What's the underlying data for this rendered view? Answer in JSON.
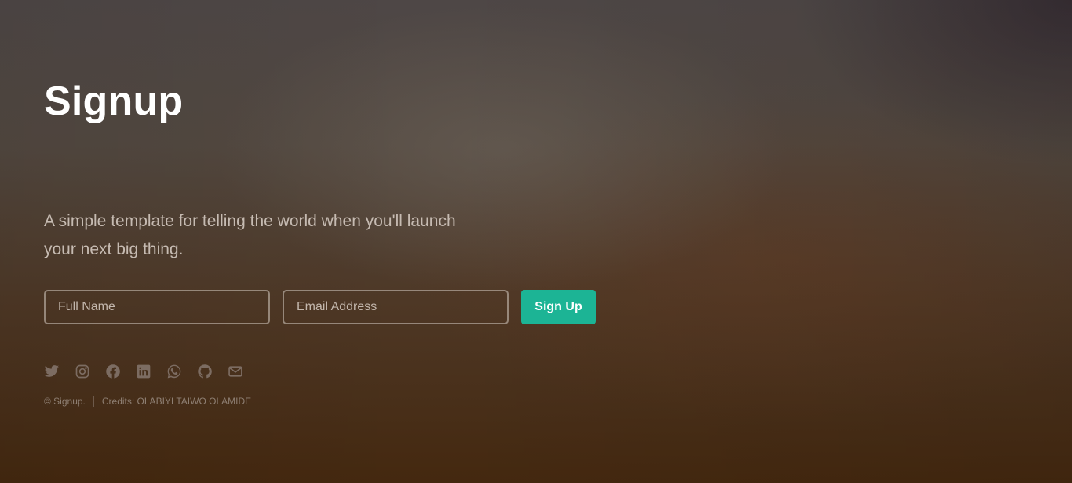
{
  "page": {
    "title": "Signup",
    "tagline": "A simple template for telling the world when you'll launch your next big thing."
  },
  "form": {
    "name_placeholder": "Full Name",
    "email_placeholder": "Email Address",
    "submit_label": "Sign Up",
    "accent_color": "#1cb495"
  },
  "socials": [
    {
      "icon": "twitter-icon"
    },
    {
      "icon": "instagram-icon"
    },
    {
      "icon": "facebook-icon"
    },
    {
      "icon": "linkedin-icon"
    },
    {
      "icon": "whatsapp-icon"
    },
    {
      "icon": "github-icon"
    },
    {
      "icon": "mail-icon"
    }
  ],
  "footer": {
    "copyright": "© Signup.",
    "credits": "Credits: OLABIYI TAIWO OLAMIDE"
  }
}
